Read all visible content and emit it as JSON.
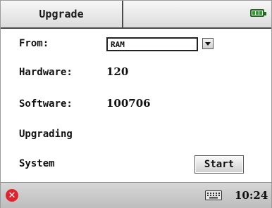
{
  "header": {
    "title": "Upgrade",
    "battery_icon": "battery-full-icon"
  },
  "form": {
    "from_label": "From:",
    "from_value": "RAM",
    "hardware_label": "Hardware:",
    "hardware_value": "120",
    "software_label": "Software:",
    "software_value": "100706",
    "upgrading_label": "Upgrading",
    "system_label": "System",
    "start_label": "Start"
  },
  "taskbar": {
    "close_icon": "close-icon",
    "close_glyph": "✕",
    "keyboard_icon": "keyboard-icon",
    "time": "10:24"
  },
  "colors": {
    "close_red": "#e0242f",
    "battery_green": "#2e9b2e"
  }
}
